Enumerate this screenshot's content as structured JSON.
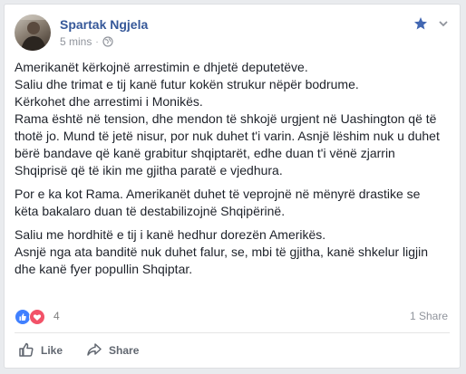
{
  "post": {
    "author": "Spartak Ngjela",
    "timestamp": "5 mins",
    "separator": "·",
    "privacy_icon": "globe-icon",
    "paragraphs": [
      {
        "lines": [
          "Amerikanët kërkojnë arrestimin e dhjetë deputetëve.",
          "Saliu dhe trimat e tij kanë futur kokën strukur nëpër bodrume.",
          "Kërkohet dhe arrestimi i Monikës.",
          "Rama është në tension, dhe mendon të shkojë urgjent në Uashington që të",
          "thotë jo. Mund të jetë nisur, por nuk duhet t'i varin. Asnjë lëshim nuk u duhet",
          "bërë bandave që kanë grabitur shqiptarët, edhe duan t'i vënë zjarrin",
          "Shqiprisë që të ikin me gjitha paratë e vjedhura."
        ]
      },
      {
        "lines": [
          "Por e ka kot Rama. Amerikanët duhet të veprojnë në mënyrë drastike se",
          "këta bakalaro duan të destabilizojnë Shqipërinë."
        ]
      },
      {
        "lines": [
          "Saliu me hordhitë e tij i kanë hedhur dorezën Amerikës.",
          "Asnjë nga ata banditë nuk duhet falur, se, mbi të gjitha, kanë shkelur ligjin",
          "dhe kanë fyer popullin Shqiptar."
        ]
      }
    ]
  },
  "reactions": {
    "icons": [
      "like-icon",
      "love-icon"
    ],
    "count": "4",
    "shares": "1 Share"
  },
  "actions": {
    "like_label": "Like",
    "share_label": "Share"
  },
  "colors": {
    "author": "#365899",
    "meta": "#90949c",
    "like_reaction": "#4080ff",
    "love_reaction": "#f25268",
    "star": "#4267b2"
  }
}
